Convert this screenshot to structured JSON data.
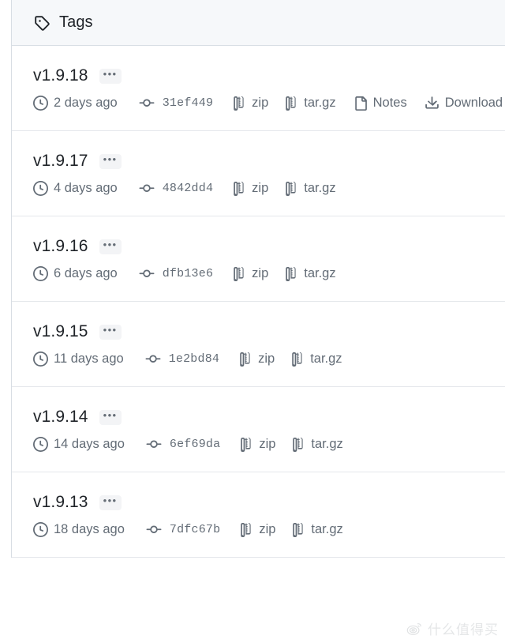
{
  "header": {
    "title": "Tags",
    "icon": "tag-icon",
    "background": "#f6f8fa",
    "border_color": "#d8dee4"
  },
  "icons": {
    "clock": "clock-icon",
    "commit": "git-commit-icon",
    "file_zip": "file-zip-icon",
    "file": "file-icon",
    "download": "download-icon",
    "kebab": "kebab-horizontal-icon"
  },
  "labels": {
    "kebab": "•••",
    "zip": "zip",
    "targz": "tar.gz",
    "notes": "Notes",
    "download": "Download"
  },
  "colors": {
    "text_primary": "#1f2328",
    "text_muted": "#636c76",
    "row_border": "#e4e7eb",
    "panel_border": "#d8dee4",
    "kebab_bg": "#f3f4f6"
  },
  "tags": [
    {
      "name": "v1.9.18",
      "time": "2 days ago",
      "commit": "31ef449",
      "zip": "zip",
      "targz": "tar.gz",
      "notes": "Notes",
      "download": "Download",
      "has_notes": true,
      "has_download": true
    },
    {
      "name": "v1.9.17",
      "time": "4 days ago",
      "commit": "4842dd4",
      "zip": "zip",
      "targz": "tar.gz",
      "has_notes": false,
      "has_download": false
    },
    {
      "name": "v1.9.16",
      "time": "6 days ago",
      "commit": "dfb13e6",
      "zip": "zip",
      "targz": "tar.gz",
      "has_notes": false,
      "has_download": false
    },
    {
      "name": "v1.9.15",
      "time": "11 days ago",
      "commit": "1e2bd84",
      "zip": "zip",
      "targz": "tar.gz",
      "has_notes": false,
      "has_download": false
    },
    {
      "name": "v1.9.14",
      "time": "14 days ago",
      "commit": "6ef69da",
      "zip": "zip",
      "targz": "tar.gz",
      "has_notes": false,
      "has_download": false
    },
    {
      "name": "v1.9.13",
      "time": "18 days ago",
      "commit": "7dfc67b",
      "zip": "zip",
      "targz": "tar.gz",
      "has_notes": false,
      "has_download": false
    }
  ],
  "watermark": {
    "text": "什么值得买",
    "logo": "weibo-logo-icon"
  }
}
